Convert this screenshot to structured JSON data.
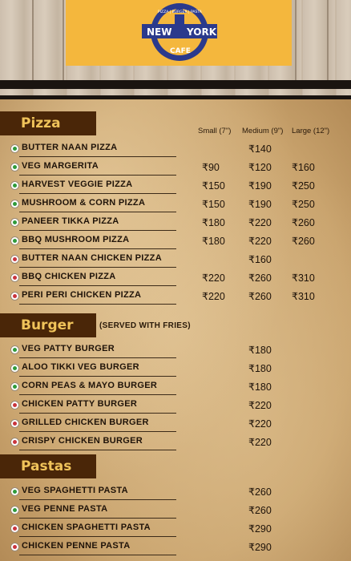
{
  "header": {
    "logo_top_text": "PIZZA | BURGER | PASTA",
    "logo_left_word": "NEW",
    "logo_right_word": "YORK",
    "logo_bottom_word": "CAFE"
  },
  "columns": {
    "small": "Small (7\")",
    "medium": "Medium (9\")",
    "large": "Large (12\")"
  },
  "sections": {
    "pizza": {
      "title": "Pizza",
      "items": [
        {
          "name": "BUTTER NAAN PIZZA",
          "type": "veg",
          "small": "",
          "medium": "₹140",
          "large": ""
        },
        {
          "name": "VEG MARGERITA",
          "type": "veg",
          "small": "₹90",
          "medium": "₹120",
          "large": "₹160"
        },
        {
          "name": "HARVEST VEGGIE PIZZA",
          "type": "veg",
          "small": "₹150",
          "medium": "₹190",
          "large": "₹250"
        },
        {
          "name": "MUSHROOM & CORN PIZZA",
          "type": "veg",
          "small": "₹150",
          "medium": "₹190",
          "large": "₹250"
        },
        {
          "name": "PANEER TIKKA PIZZA",
          "type": "veg",
          "small": "₹180",
          "medium": "₹220",
          "large": "₹260"
        },
        {
          "name": "BBQ MUSHROOM PIZZA",
          "type": "veg",
          "small": "₹180",
          "medium": "₹220",
          "large": "₹260"
        },
        {
          "name": "BUTTER NAAN CHICKEN PIZZA",
          "type": "nonveg",
          "small": "",
          "medium": "₹160",
          "large": ""
        },
        {
          "name": "BBQ CHICKEN PIZZA",
          "type": "nonveg",
          "small": "₹220",
          "medium": "₹260",
          "large": "₹310"
        },
        {
          "name": "PERI PERI CHICKEN PIZZA",
          "type": "nonveg",
          "small": "₹220",
          "medium": "₹260",
          "large": "₹310"
        }
      ]
    },
    "burger": {
      "title": "Burger",
      "note": "(SERVED WITH FRIES)",
      "items": [
        {
          "name": "VEG PATTY BURGER",
          "type": "veg",
          "price": "₹180"
        },
        {
          "name": "ALOO TIKKI VEG BURGER",
          "type": "veg",
          "price": "₹180"
        },
        {
          "name": "CORN PEAS & MAYO BURGER",
          "type": "veg",
          "price": "₹180"
        },
        {
          "name": "CHICKEN PATTY BURGER",
          "type": "nonveg",
          "price": "₹220"
        },
        {
          "name": "GRILLED CHICKEN BURGER",
          "type": "nonveg",
          "price": "₹220"
        },
        {
          "name": "CRISPY CHICKEN BURGER",
          "type": "nonveg",
          "price": "₹220"
        }
      ]
    },
    "pastas": {
      "title": "Pastas",
      "items": [
        {
          "name": "VEG SPAGHETTI PASTA",
          "type": "veg",
          "price": "₹260"
        },
        {
          "name": "VEG PENNE PASTA",
          "type": "veg",
          "price": "₹260"
        },
        {
          "name": "CHICKEN SPAGHETTI PASTA",
          "type": "nonveg",
          "price": "₹290"
        },
        {
          "name": "CHICKEN PENNE PASTA",
          "type": "nonveg",
          "price": "₹290"
        }
      ]
    }
  },
  "colors": {
    "veg": "#2f9a3a",
    "nonveg": "#c9353d",
    "tab": "#4a2608",
    "tab_text": "#f0c35a",
    "logo_bg": "#f4b73d",
    "logo_ring": "#2b3a8c"
  }
}
